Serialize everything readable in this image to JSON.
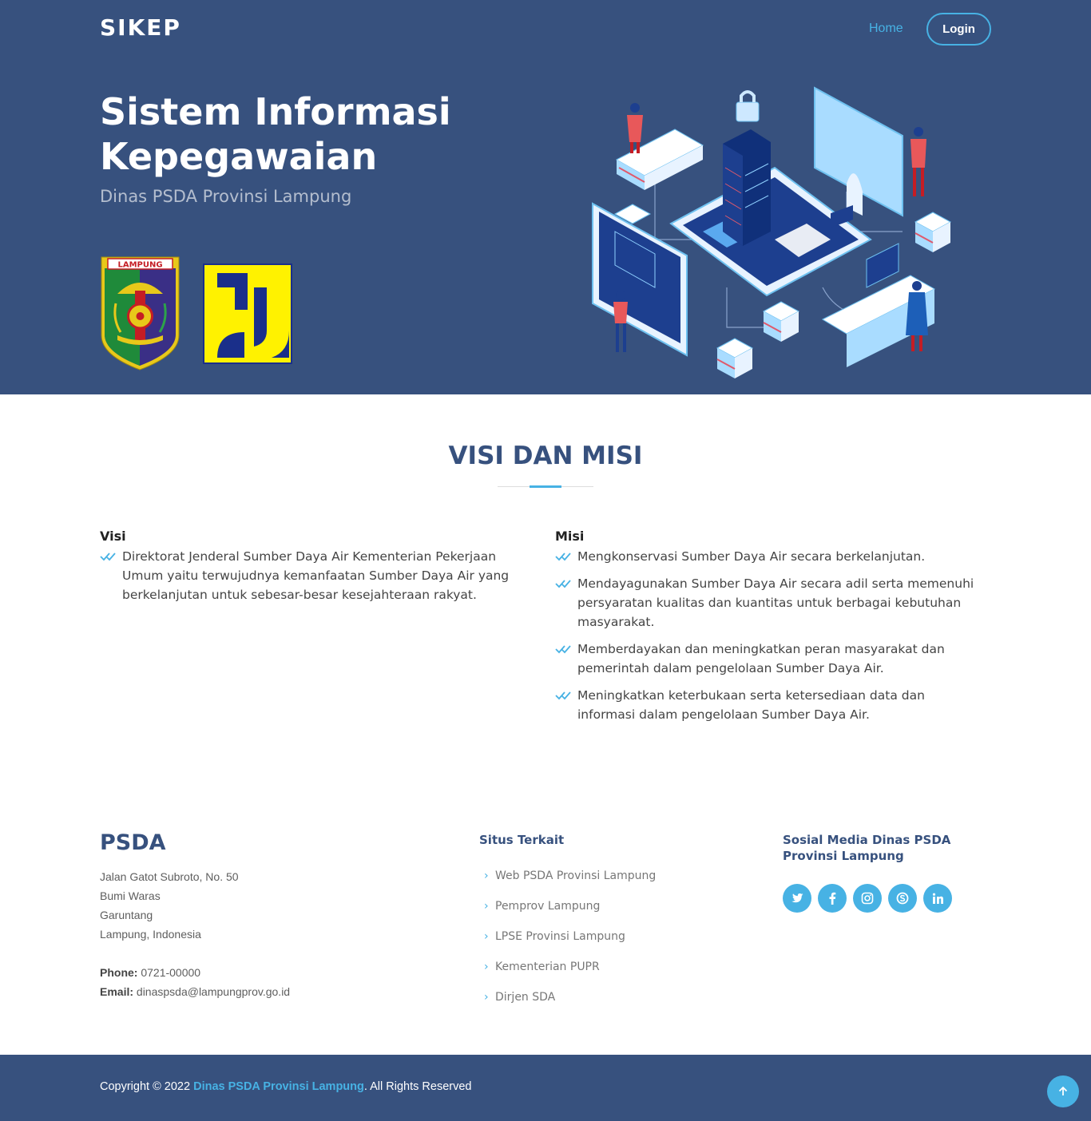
{
  "header": {
    "brand": "SIKEP",
    "nav_home": "Home",
    "nav_login": "Login"
  },
  "hero": {
    "title": "Sistem Informasi Kepegawaian",
    "subtitle": "Dinas PSDA Provinsi Lampung",
    "logo_lampung_text": "LAMPUNG"
  },
  "visi_misi": {
    "title": "VISI DAN MISI",
    "visi_heading": "Visi",
    "visi_items": [
      "Direktorat Jenderal Sumber Daya Air Kementerian Pekerjaan Umum yaitu terwujudnya kemanfaatan Sumber Daya Air yang berkelanjutan untuk sebesar-besar kesejahteraan rakyat."
    ],
    "misi_heading": "Misi",
    "misi_items": [
      "Mengkonservasi Sumber Daya Air secara berkelanjutan.",
      "Mendayagunakan Sumber Daya Air secara adil serta memenuhi persyaratan kualitas dan kuantitas untuk berbagai kebutuhan masyarakat.",
      "Memberdayakan dan meningkatkan peran masyarakat dan pemerintah dalam pengelolaan Sumber Daya Air.",
      "Meningkatkan keterbukaan serta ketersediaan data dan informasi dalam pengelolaan Sumber Daya Air."
    ]
  },
  "footer": {
    "brand": "PSDA",
    "address_lines": [
      "Jalan Gatot Subroto, No. 50",
      "Bumi Waras",
      "Garuntang",
      "Lampung, Indonesia"
    ],
    "phone_label": "Phone:",
    "phone": "0721-00000",
    "email_label": "Email:",
    "email": "dinaspsda@lampungprov.go.id",
    "links_heading": "Situs Terkait",
    "links": [
      "Web PSDA Provinsi Lampung",
      "Pemprov Lampung",
      "LPSE Provinsi Lampung",
      "Kementerian PUPR",
      "Dirjen SDA"
    ],
    "social_heading": "Sosial Media Dinas PSDA Provinsi Lampung",
    "socials": [
      "twitter-icon",
      "facebook-icon",
      "instagram-icon",
      "skype-icon",
      "linkedin-icon"
    ],
    "copyright_prefix": "Copyright © 2022 ",
    "copyright_org": "Dinas PSDA Provinsi Lampung",
    "copyright_suffix": ". All Rights Reserved"
  },
  "colors": {
    "primary": "#37517e",
    "accent": "#47b2e4"
  }
}
